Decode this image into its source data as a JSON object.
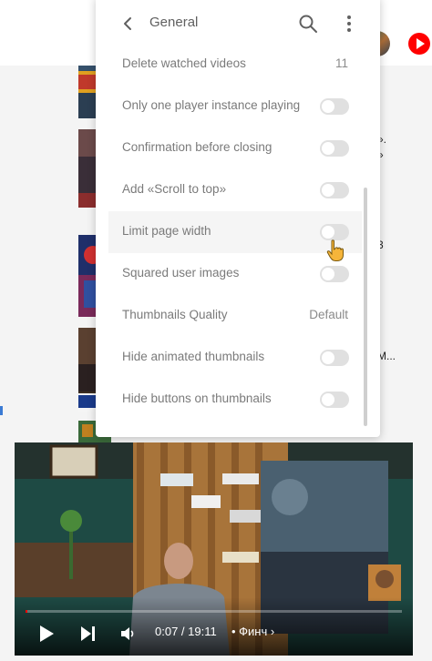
{
  "panel": {
    "title": "General",
    "back_icon": "arrow-left-icon",
    "search_icon": "search-icon",
    "more_icon": "more-vertical-icon"
  },
  "settings": [
    {
      "label": "Delete watched videos",
      "value": "11"
    },
    {
      "label": "Only one player instance playing",
      "toggle": false
    },
    {
      "label": "Confirmation before closing",
      "toggle": false
    },
    {
      "label": "Add «Scroll to top»",
      "toggle": false
    },
    {
      "label": "Limit page width",
      "toggle": false,
      "highlighted": true
    },
    {
      "label": "Squared user images",
      "toggle": false
    },
    {
      "label": "Thumbnails Quality",
      "value": "Default"
    },
    {
      "label": "Hide animated thumbnails",
      "toggle": false
    },
    {
      "label": "Hide buttons on thumbnails",
      "toggle": false
    }
  ],
  "background": {
    "side_texts": [
      "».",
      "»",
      "3",
      "М..."
    ]
  },
  "player": {
    "time": "0:07 / 19:11",
    "chapter": "• Финч ›",
    "progress": 0.006,
    "play_icon": "play-icon",
    "next_icon": "skip-next-icon",
    "volume_icon": "volume-icon"
  },
  "colors": {
    "accent_red": "#ff0000",
    "toggle_off": "#e0e0e0",
    "label_gray": "#7a7a7a"
  }
}
